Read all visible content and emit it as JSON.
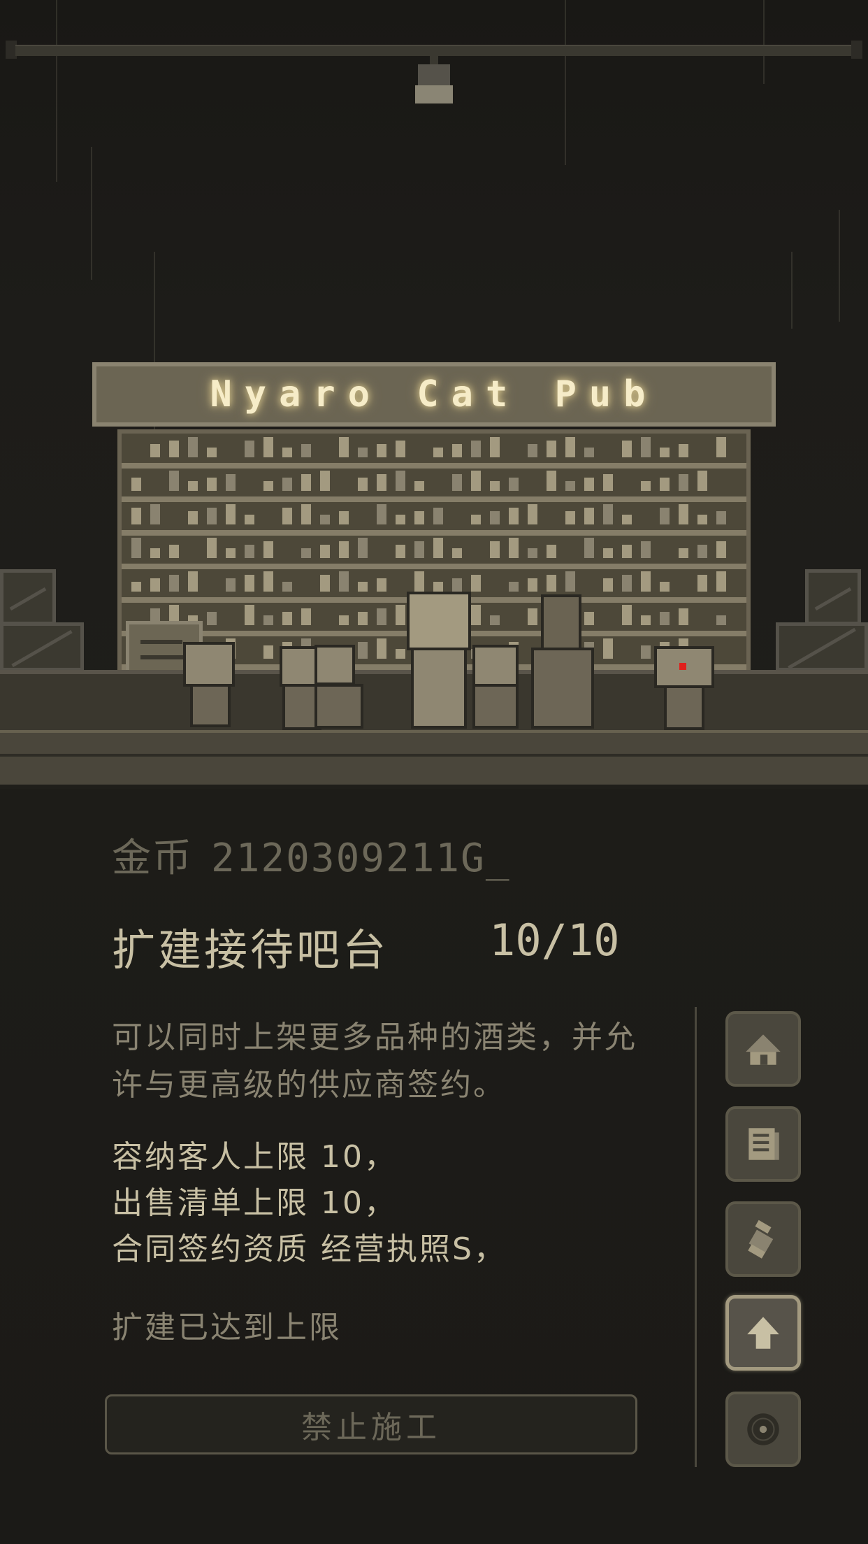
{
  "scene": {
    "sign_text": "Nyaro Cat Pub"
  },
  "panel": {
    "gold_label": "金币",
    "gold_value": "21203092",
    "gold_suffix": "11G_",
    "title": "扩建接待吧台",
    "level": "10/10",
    "description": "可以同时上架更多品种的酒类，并允许与更高级的供应商签约。",
    "stats": [
      "容纳客人上限 10，",
      "出售清单上限 10，",
      "合同签约资质 经营执照S，"
    ],
    "max_notice": "扩建已达到上限",
    "button_label": "禁止施工"
  },
  "side_menu": [
    {
      "icon": "house-icon",
      "active": false
    },
    {
      "icon": "menu-list-icon",
      "active": false
    },
    {
      "icon": "scroll-icon",
      "active": false
    },
    {
      "icon": "upgrade-arrow-icon",
      "active": true
    },
    {
      "icon": "record-disc-icon",
      "active": false
    }
  ],
  "colors": {
    "background": "#1b1a17",
    "text_primary": "#c8c0a4",
    "text_muted": "#8a8472",
    "sign_glow": "#f6ecc8"
  }
}
